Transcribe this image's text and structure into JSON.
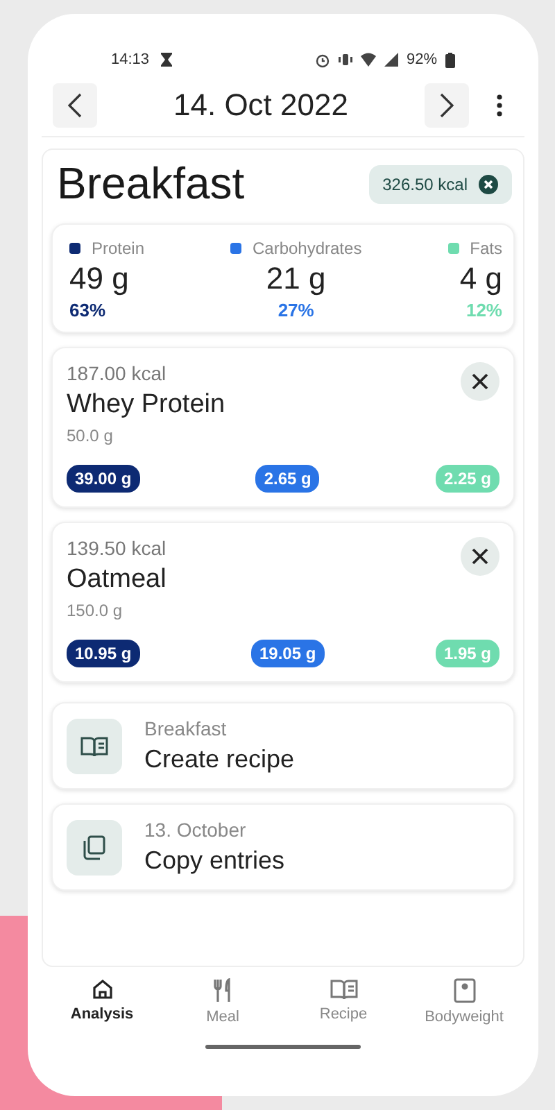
{
  "status_bar": {
    "time": "14:13",
    "battery": "92%"
  },
  "header": {
    "date": "14. Oct 2022"
  },
  "meal": {
    "title": "Breakfast",
    "total": "326.50 kcal",
    "macros": [
      {
        "name": "Protein",
        "amount": "49 g",
        "percent": "63%",
        "color": "#0d2a73"
      },
      {
        "name": "Carbohydrates",
        "amount": "21 g",
        "percent": "27%",
        "color": "#2a74e6"
      },
      {
        "name": "Fats",
        "amount": "4 g",
        "percent": "12%",
        "color": "#6fdcaf"
      }
    ],
    "entries": [
      {
        "kcal": "187.00 kcal",
        "name": "Whey Protein",
        "weight": "50.0 g",
        "amounts": [
          "39.00 g",
          "2.65 g",
          "2.25 g"
        ]
      },
      {
        "kcal": "139.50 kcal",
        "name": "Oatmeal",
        "weight": "150.0 g",
        "amounts": [
          "10.95 g",
          "19.05 g",
          "1.95 g"
        ]
      }
    ],
    "actions": [
      {
        "kind": "recipe",
        "caption": "Breakfast",
        "label": "Create recipe"
      },
      {
        "kind": "copy",
        "caption": "13. October",
        "label": "Copy entries"
      }
    ]
  },
  "nav": [
    {
      "kind": "analysis",
      "label": "Analysis",
      "selected": true
    },
    {
      "kind": "meal",
      "label": "Meal",
      "selected": false
    },
    {
      "kind": "recipe",
      "label": "Recipe",
      "selected": false
    },
    {
      "kind": "bodyweight",
      "label": "Bodyweight",
      "selected": false
    }
  ]
}
